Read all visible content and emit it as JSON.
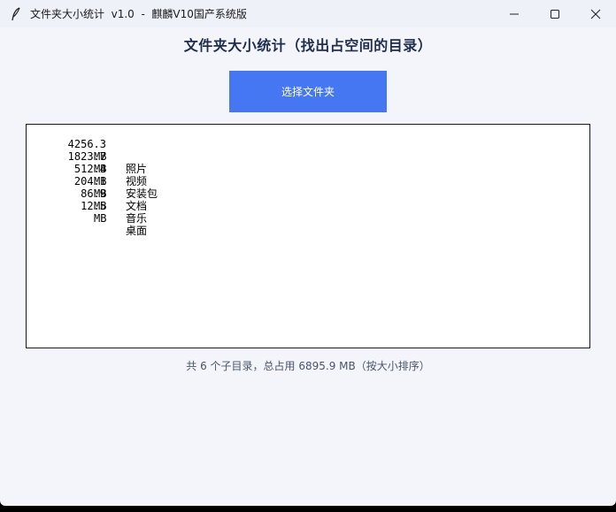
{
  "window": {
    "title": "文件夹大小统计  v1.0  -  麒麟V10国产系统版"
  },
  "header": {
    "title": "文件夹大小统计（找出占空间的目录）"
  },
  "toolbar": {
    "select_folder_label": "选择文件夹",
    "accent_color": "#4677f2"
  },
  "list": {
    "items": [
      {
        "size": "4256.3",
        "unit": "MB",
        "name": "照片"
      },
      {
        "size": "1823.7",
        "unit": "MB",
        "name": "视频"
      },
      {
        "size": "512.4",
        "unit": "MB",
        "name": "安装包"
      },
      {
        "size": "204.1",
        "unit": "MB",
        "name": "文档"
      },
      {
        "size": "86.9",
        "unit": "MB",
        "name": "音乐"
      },
      {
        "size": "12.5",
        "unit": "MB",
        "name": "桌面"
      }
    ]
  },
  "status": {
    "summary": "共 6 个子目录，总占用 6895.9 MB（按大小排序）"
  },
  "icons": {
    "app": "feather-icon",
    "minimize": "minimize-icon",
    "maximize": "maximize-icon",
    "close": "close-icon"
  }
}
